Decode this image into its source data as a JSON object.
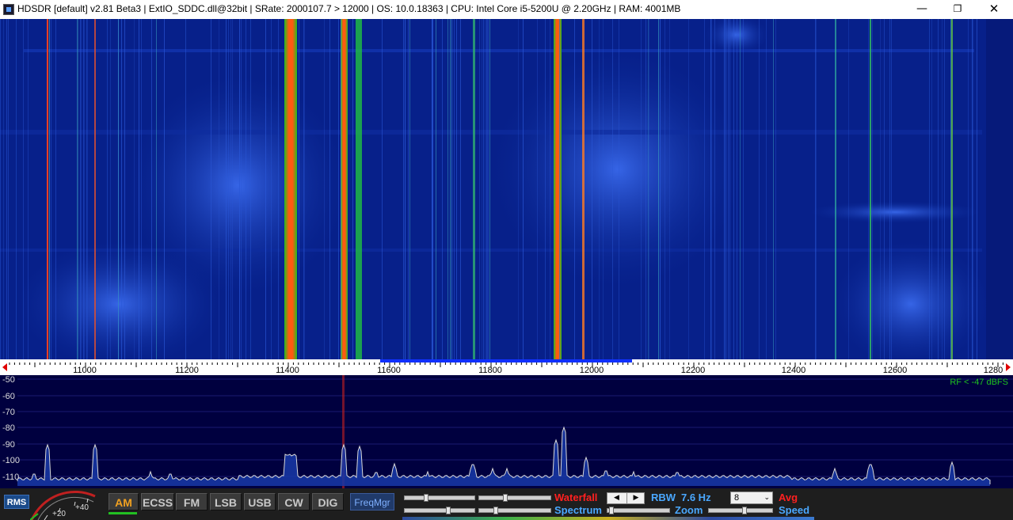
{
  "window": {
    "title": "HDSDR  [default]  v2.81 Beta3  |  ExtIO_SDDC.dll@32bit  |  SRate: 2000107.7 > 12000  |  OS: 10.0.18363  |  CPU: Intel Core i5-5200U @ 2.20GHz  |  RAM: 4001MB",
    "minimize": "—",
    "maximize": "❐",
    "close": "✕"
  },
  "freq_scale": {
    "ticks": [
      "11000",
      "11200",
      "11400",
      "11600",
      "11800",
      "12000",
      "12200",
      "12400",
      "12600",
      "1280"
    ]
  },
  "spectrum": {
    "db_labels": [
      "-50",
      "-60",
      "-70",
      "-80",
      "-90",
      "-100",
      "-110"
    ],
    "rf_indicator": "RF < -47 dBFS"
  },
  "controls": {
    "rms_label": "RMS",
    "smeter_labels": [
      "+20",
      "+40"
    ],
    "modes": [
      {
        "label": "AM",
        "active": true
      },
      {
        "label": "ECSS",
        "active": false
      },
      {
        "label": "FM",
        "active": false
      },
      {
        "label": "LSB",
        "active": false
      },
      {
        "label": "USB",
        "active": false
      },
      {
        "label": "CW",
        "active": false
      },
      {
        "label": "DIG",
        "active": false
      }
    ],
    "freqmgr_label": "FreqMgr",
    "waterfall_label": "Waterfall",
    "spectrum_label": "Spectrum",
    "rbw_label": "RBW",
    "rbw_value": "7.6 Hz",
    "zoom_label": "Zoom",
    "avg_value": "8",
    "avg_label": "Avg",
    "speed_label": "Speed",
    "stepper_left": "◀",
    "stepper_right": "▶"
  }
}
